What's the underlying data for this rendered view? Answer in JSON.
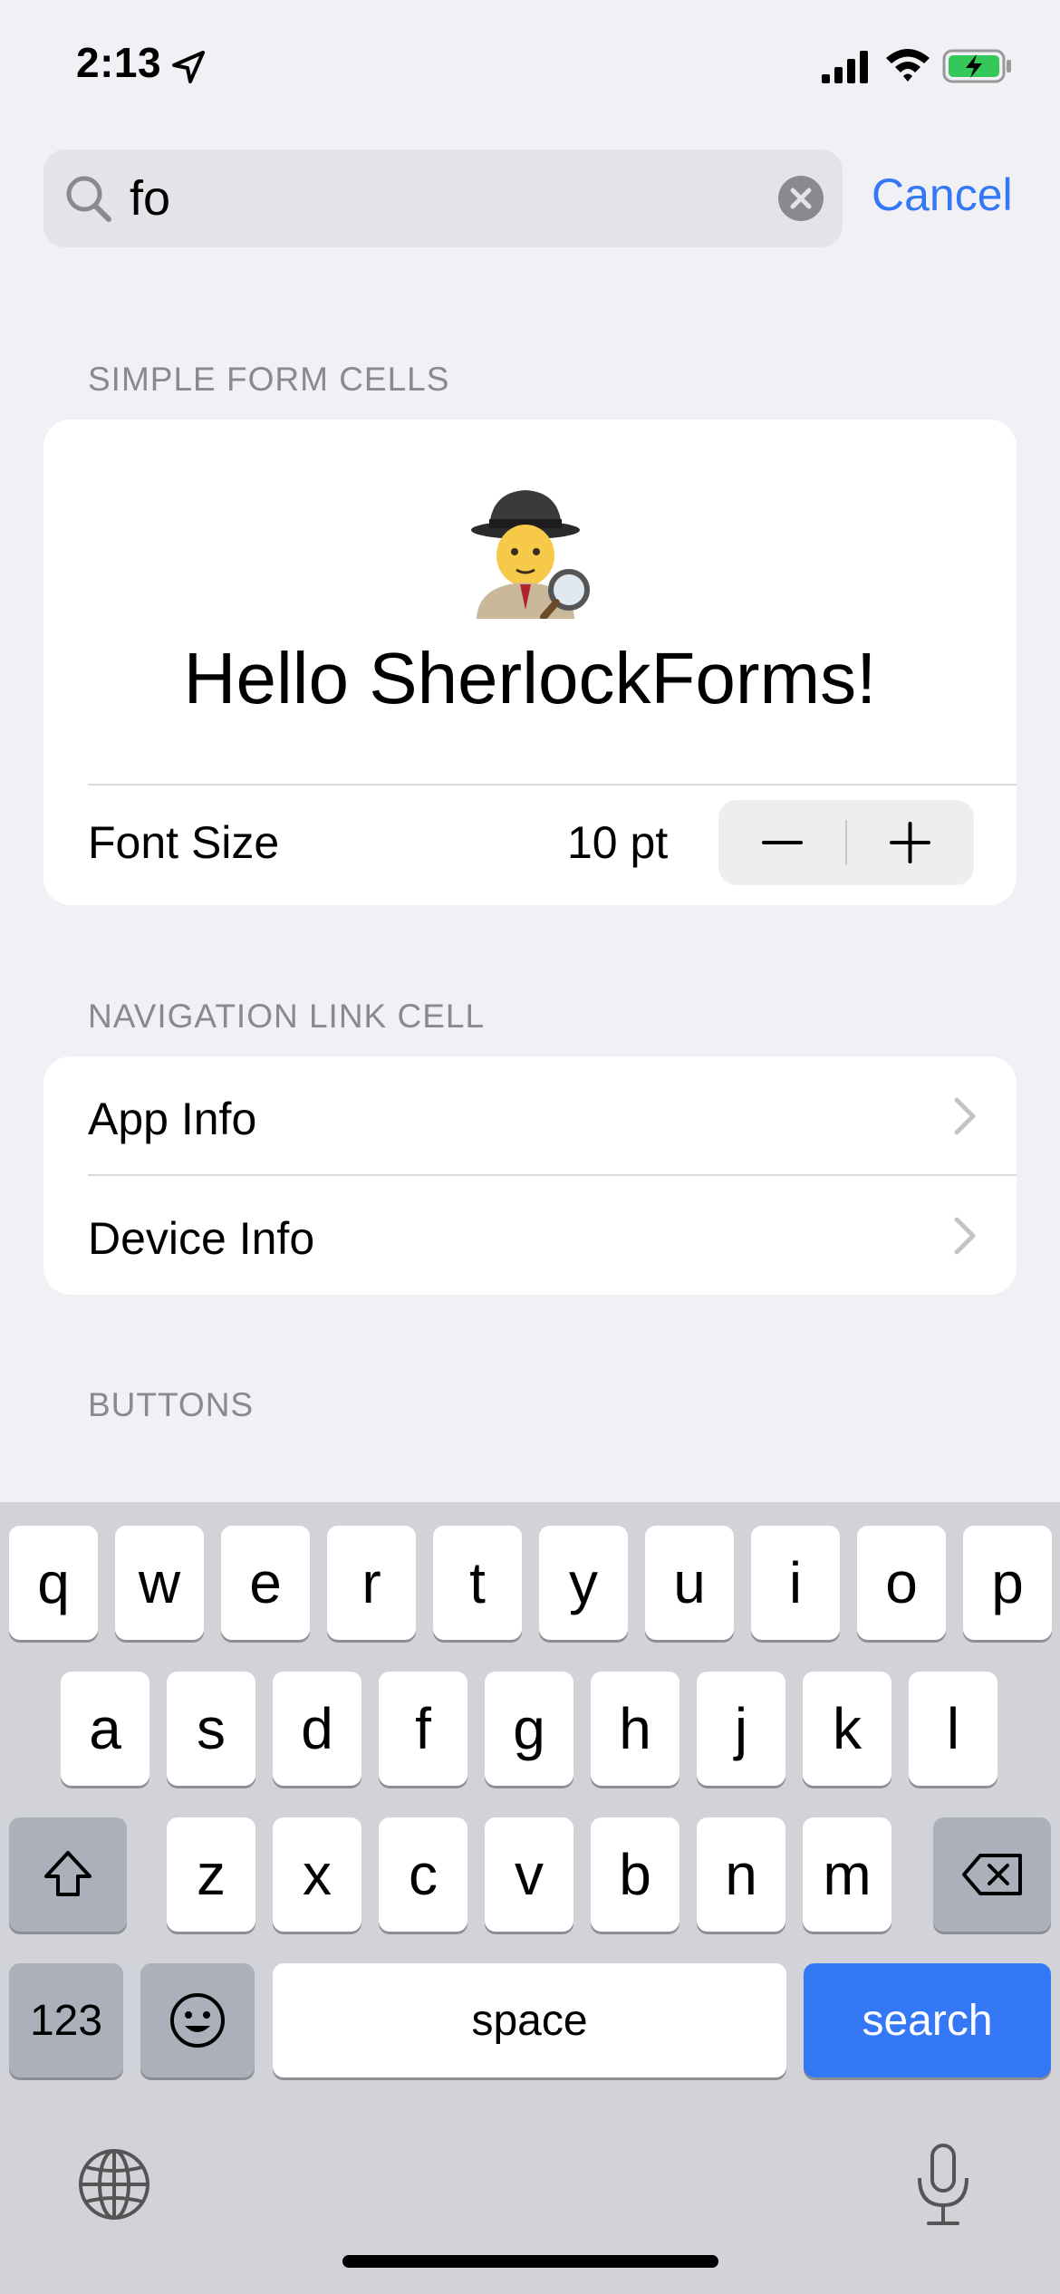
{
  "status_bar": {
    "time": "2:13"
  },
  "search": {
    "value": "fo",
    "cancel_label": "Cancel"
  },
  "sections": {
    "simple_form": {
      "header": "SIMPLE FORM CELLS",
      "hello_text": "Hello SherlockForms!",
      "font_size_label": "Font Size",
      "font_size_value": "10 pt"
    },
    "navigation": {
      "header": "NAVIGATION LINK CELL",
      "items": [
        {
          "label": "App Info"
        },
        {
          "label": "Device Info"
        }
      ]
    },
    "buttons": {
      "header": "BUTTONS"
    }
  },
  "keyboard": {
    "row1": [
      "q",
      "w",
      "e",
      "r",
      "t",
      "y",
      "u",
      "i",
      "o",
      "p"
    ],
    "row2": [
      "a",
      "s",
      "d",
      "f",
      "g",
      "h",
      "j",
      "k",
      "l"
    ],
    "row3": [
      "z",
      "x",
      "c",
      "v",
      "b",
      "n",
      "m"
    ],
    "numbers_label": "123",
    "space_label": "space",
    "return_label": "search"
  },
  "colors": {
    "accent": "#3478f6",
    "background": "#f0f0f5",
    "keyboard_bg": "#d1d3d9"
  }
}
